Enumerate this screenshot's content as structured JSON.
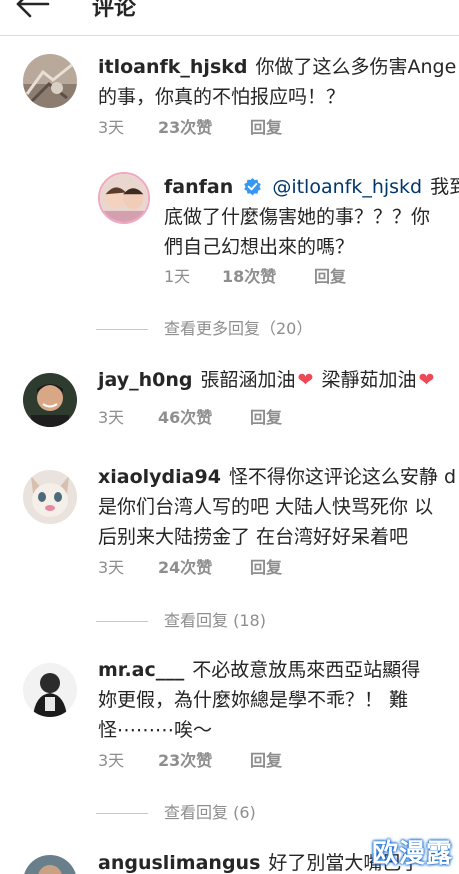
{
  "header": {
    "title": "评论"
  },
  "comments": [
    {
      "username": "itloanfk_hjskd",
      "lines": [
        "你做了这么多伤害Ange",
        "的事，你真的不怕报应吗！？"
      ],
      "time": "3天",
      "likes": "23次赞",
      "reply": "回复",
      "replies": [
        {
          "username": "fanfan",
          "mention": "@itloanfk_hjskd",
          "lines": [
            "我到",
            "底做了什麼傷害她的事？？？你",
            "們自己幻想出來的嗎？"
          ],
          "time": "1天",
          "likes": "18次赞",
          "reply": "回复"
        }
      ],
      "view_more": "查看更多回复（20）"
    },
    {
      "username": "jay_h0ng",
      "text_a": "張韶涵加油",
      "text_b": "梁靜茹加油",
      "heart": "❤",
      "time": "3天",
      "likes": "46次赞",
      "reply": "回复"
    },
    {
      "username": "xiaolydia94",
      "lines": [
        "怪不得你这评论这么安静 d",
        "是你们台湾人写的吧 大陆人快骂死你 以",
        "后别来大陆捞金了 在台湾好好呆着吧"
      ],
      "time": "3天",
      "likes": "24次赞",
      "reply": "回复",
      "view_more": "查看回复 (18)"
    },
    {
      "username": "mr.ac___",
      "lines": [
        "不必故意放馬來西亞站顯得",
        "妳更假，為什麼妳總是學不乖？！ 難",
        "怪⋯⋯⋯唉～"
      ],
      "time": "3天",
      "likes": "23次赞",
      "reply": "回复",
      "view_more": "查看回复 (6)"
    },
    {
      "username": "anguslimangus",
      "lines": [
        "好了別當大嘴巴了"
      ]
    }
  ],
  "watermark": "欧漫露",
  "colors": {
    "text": "#262626",
    "secondary": "#8e8e8e",
    "mention": "#00376b",
    "verified": "#3897f0",
    "heart": "#ed4956"
  }
}
